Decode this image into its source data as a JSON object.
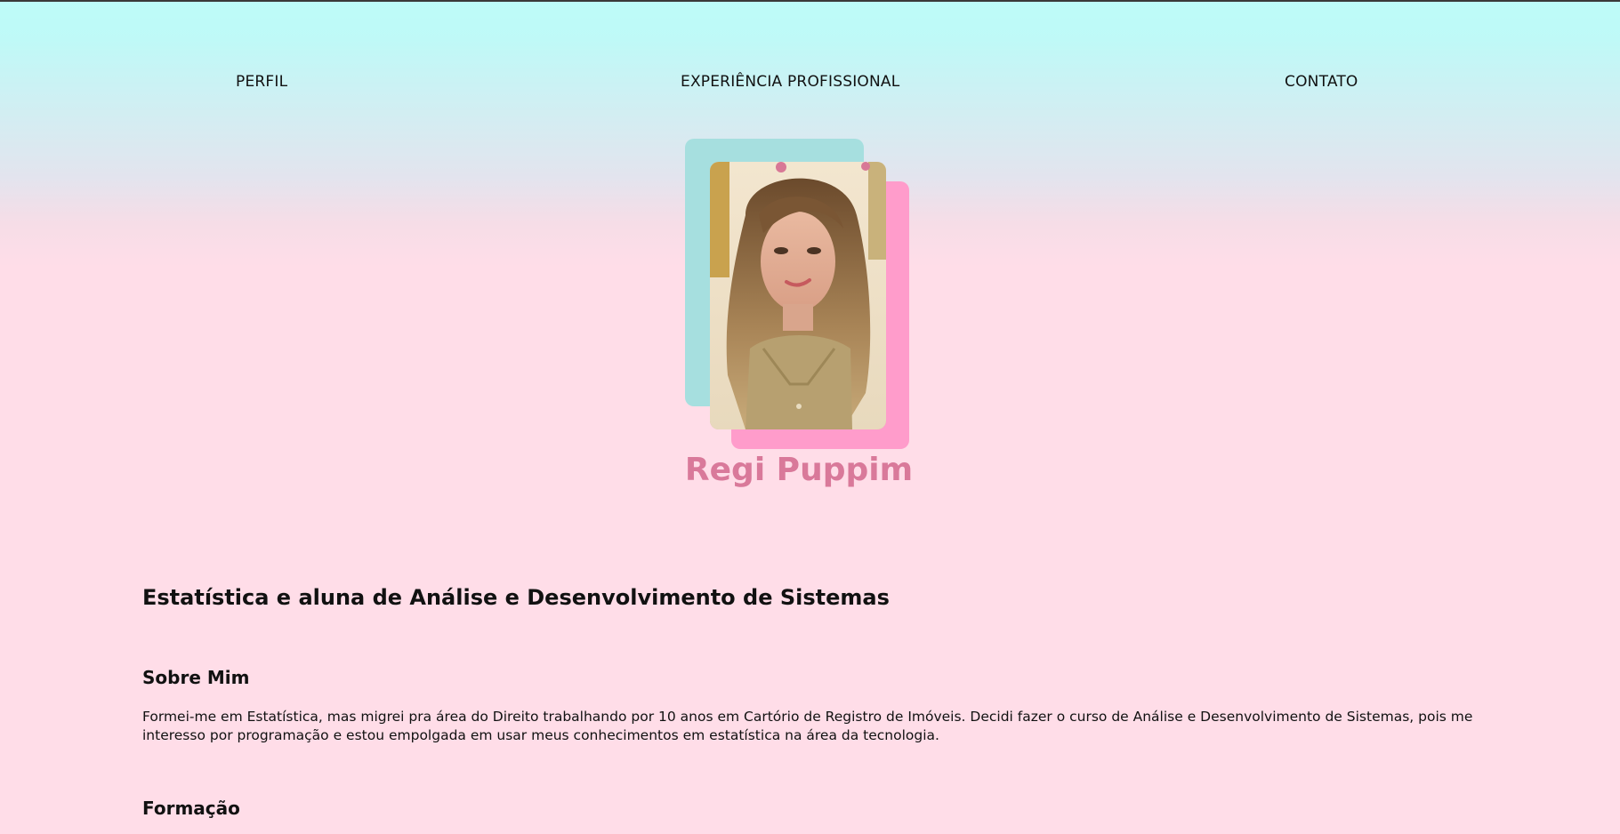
{
  "nav": {
    "perfil": "PERFIL",
    "experiencia": "EXPERIÊNCIA PROFISSIONAL",
    "contato": "CONTATO"
  },
  "profile": {
    "name": "Regi Puppim",
    "headline": "Estatística e aluna de Análise e Desenvolvimento de Sistemas",
    "photo_alt": "profile-photo"
  },
  "about": {
    "title": "Sobre Mim",
    "text": "Formei-me em Estatística, mas migrei pra área do Direito trabalhando por 10 anos em Cartório de Registro de Imóveis. Decidi fazer o curso de Análise e Desenvolvimento de Sistemas, pois me interesso por programação e estou empolgada em usar meus conhecimentos em estatística na área da tecnologia."
  },
  "formacao": {
    "title": "Formação"
  },
  "colors": {
    "accent_pink": "#ff9ccb",
    "accent_teal": "#a6dfdf",
    "name_color": "#d9799a"
  }
}
